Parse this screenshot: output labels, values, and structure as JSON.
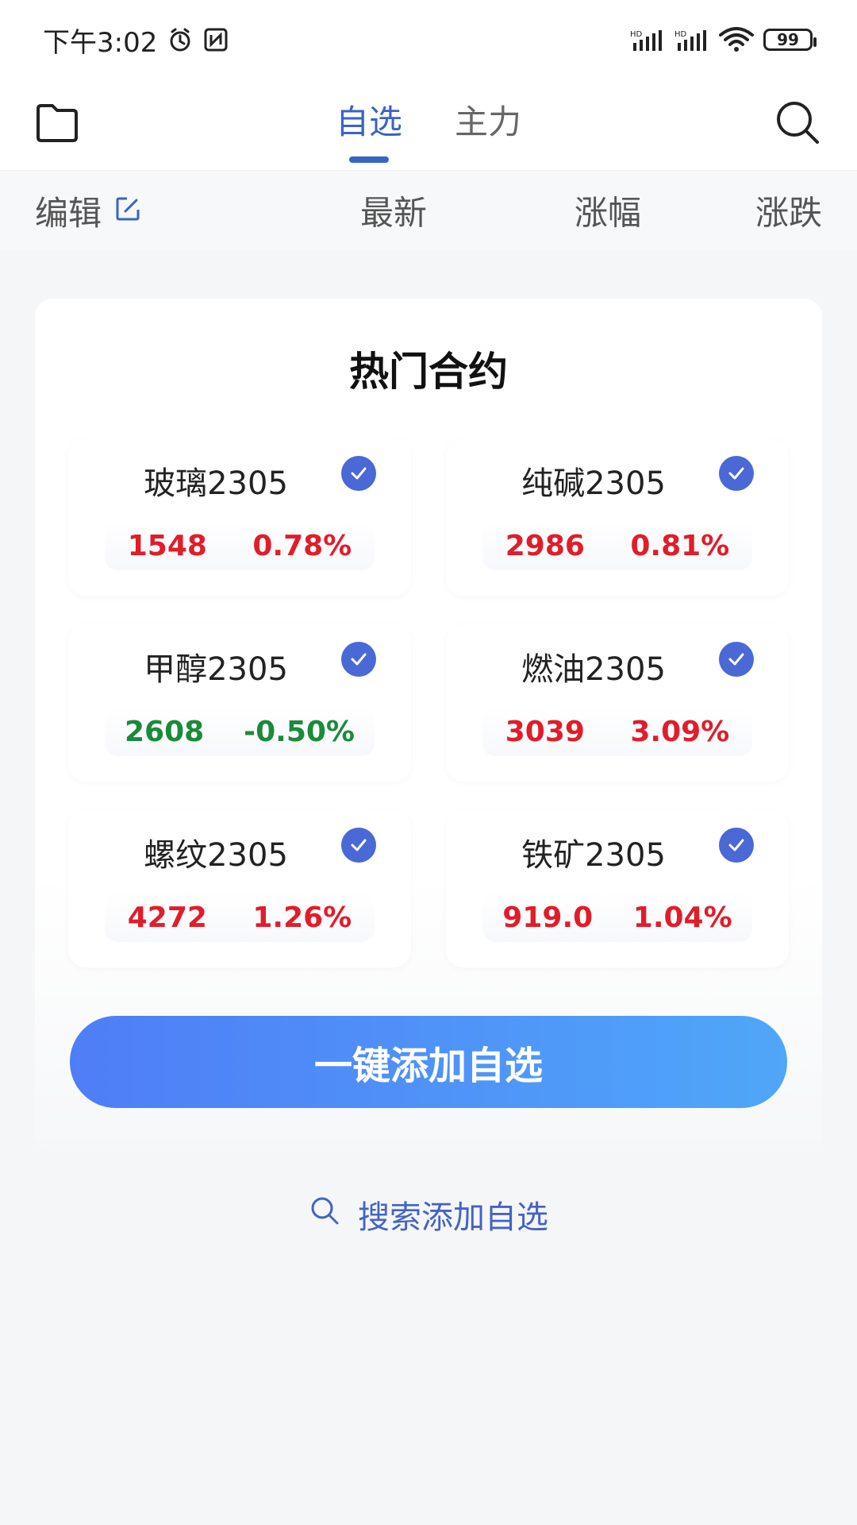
{
  "status_bar": {
    "time": "下午3:02",
    "battery": "99"
  },
  "nav": {
    "tabs": [
      {
        "label": "自选",
        "active": true
      },
      {
        "label": "主力",
        "active": false
      }
    ],
    "icons": {
      "left": "folder-icon",
      "right": "search-icon"
    }
  },
  "sort_header": {
    "edit": "编辑",
    "latest": "最新",
    "change_pct": "涨幅",
    "change": "涨跌"
  },
  "panel": {
    "title": "热门合约",
    "cards": [
      {
        "name": "玻璃2305",
        "price": "1548",
        "pct": "0.78%",
        "trend": "up"
      },
      {
        "name": "纯碱2305",
        "price": "2986",
        "pct": "0.81%",
        "trend": "up"
      },
      {
        "name": "甲醇2305",
        "price": "2608",
        "pct": "-0.50%",
        "trend": "down"
      },
      {
        "name": "燃油2305",
        "price": "3039",
        "pct": "3.09%",
        "trend": "up"
      },
      {
        "name": "螺纹2305",
        "price": "4272",
        "pct": "1.26%",
        "trend": "up"
      },
      {
        "name": "铁矿2305",
        "price": "919.0",
        "pct": "1.04%",
        "trend": "up"
      }
    ],
    "button": "一键添加自选"
  },
  "search_link": "搜索添加自选",
  "colors": {
    "accent": "#3a63c7",
    "up": "#e11d2a",
    "down": "#1a8b3a"
  }
}
